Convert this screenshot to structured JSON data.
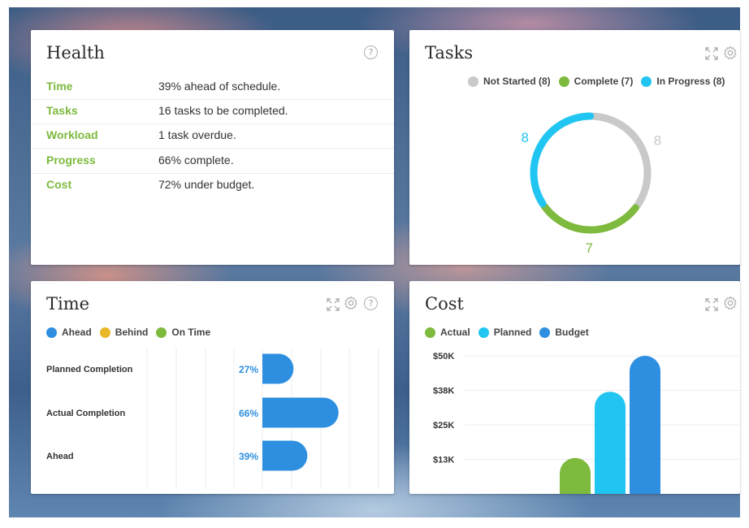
{
  "health": {
    "title": "Health",
    "help": "?",
    "rows": [
      {
        "label": "Time",
        "value": "39% ahead of schedule."
      },
      {
        "label": "Tasks",
        "value": "16 tasks to be completed."
      },
      {
        "label": "Workload",
        "value": "1 task overdue."
      },
      {
        "label": "Progress",
        "value": "66% complete."
      },
      {
        "label": "Cost",
        "value": "72% under budget."
      }
    ]
  },
  "tasks": {
    "title": "Tasks",
    "legend": [
      {
        "label": "Not Started (8)",
        "color": "#c9c9c9"
      },
      {
        "label": "Complete (7)",
        "color": "#7dba3e"
      },
      {
        "label": "In Progress (8)",
        "color": "#21c5f1"
      }
    ]
  },
  "time": {
    "title": "Time",
    "help": "?",
    "legend": [
      {
        "label": "Ahead",
        "color": "#2e8fe0"
      },
      {
        "label": "Behind",
        "color": "#e8b82a"
      },
      {
        "label": "On Time",
        "color": "#7dba3e"
      }
    ]
  },
  "cost": {
    "title": "Cost",
    "legend": [
      {
        "label": "Actual",
        "color": "#7dba3e"
      },
      {
        "label": "Planned",
        "color": "#21c5f1"
      },
      {
        "label": "Budget",
        "color": "#2e8fe0"
      }
    ]
  },
  "chart_data": [
    {
      "type": "pie",
      "categories": [
        "Not Started",
        "Complete",
        "In Progress"
      ],
      "values": [
        8,
        7,
        8
      ],
      "colors": [
        "#c9c9c9",
        "#7dba3e",
        "#21c5f1"
      ],
      "labels": [
        "8",
        "7",
        "8"
      ]
    },
    {
      "type": "bar",
      "orientation": "horizontal",
      "categories": [
        "Planned Completion",
        "Actual Completion",
        "Ahead"
      ],
      "values": [
        27,
        66,
        39
      ],
      "labels": [
        "27%",
        "66%",
        "39%"
      ],
      "color": "#2e8fe0"
    },
    {
      "type": "bar",
      "series": [
        {
          "name": "Actual",
          "values": [
            13000
          ],
          "color": "#7dba3e"
        },
        {
          "name": "Planned",
          "values": [
            37000
          ],
          "color": "#21c5f1"
        },
        {
          "name": "Budget",
          "values": [
            50000
          ],
          "color": "#2e8fe0"
        }
      ],
      "y_ticks": [
        "$50K",
        "$38K",
        "$25K",
        "$13K"
      ],
      "y_tick_values": [
        50000,
        37500,
        25000,
        12500
      ]
    }
  ]
}
